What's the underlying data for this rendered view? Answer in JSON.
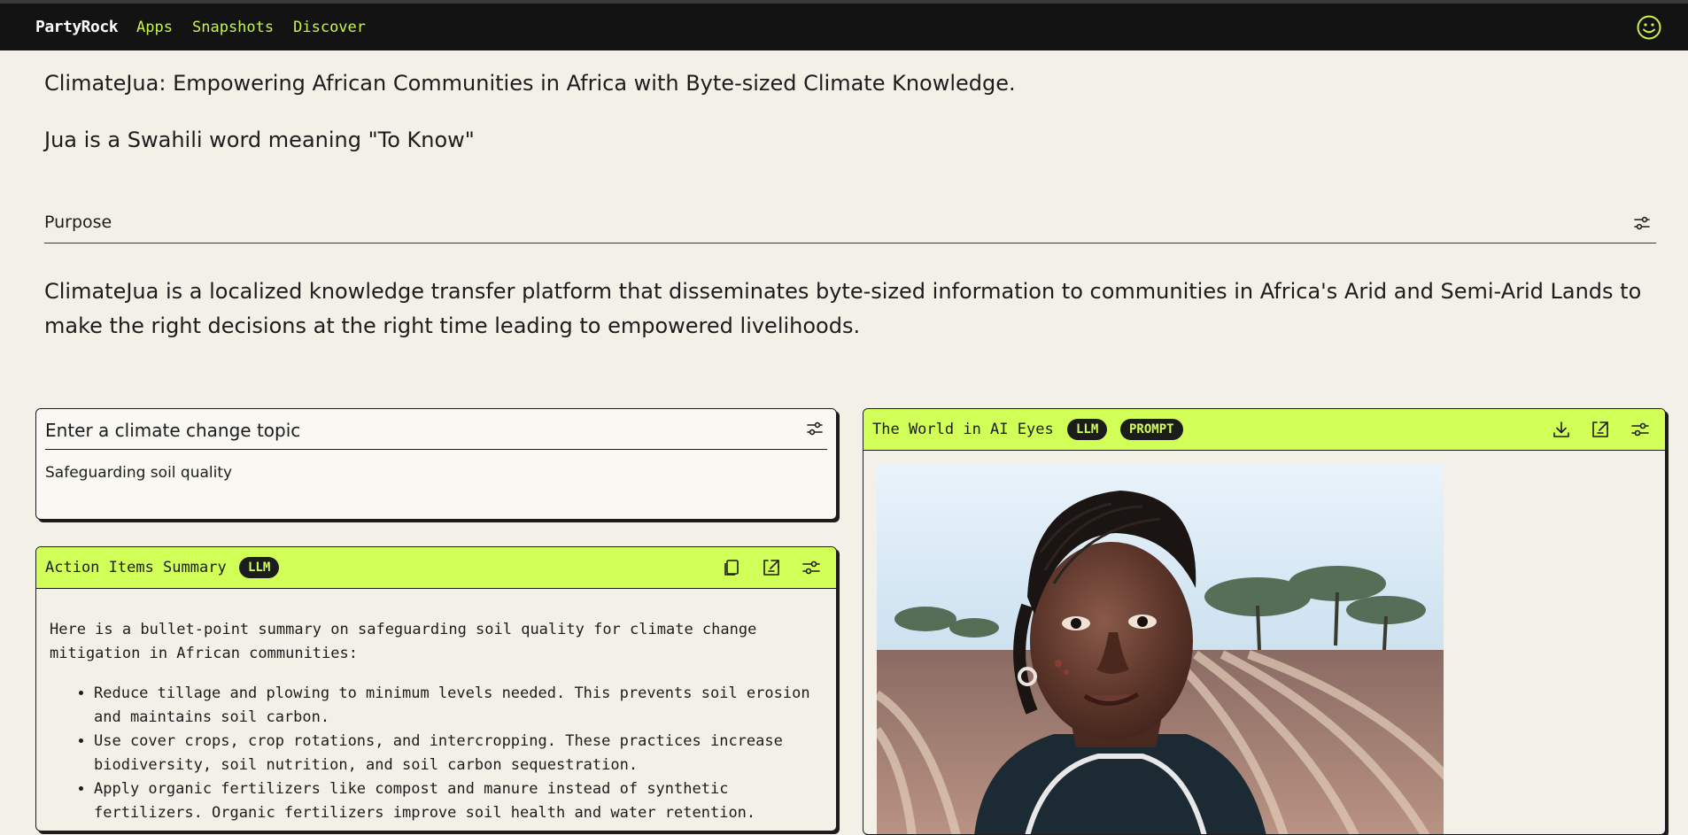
{
  "nav": {
    "brand": "PartyRock",
    "links": [
      "Apps",
      "Snapshots",
      "Discover"
    ]
  },
  "headline": "ClimateJua: Empowering African Communities in Africa with Byte-sized Climate Knowledge.",
  "subline": "Jua is a Swahili word meaning \"To Know\"",
  "purpose": {
    "label": "Purpose",
    "text": "ClimateJua is a localized knowledge transfer platform that disseminates byte-sized information to communities in Africa's Arid and Semi-Arid Lands to make the right decisions at the right time leading to empowered livelihoods."
  },
  "input_widget": {
    "title": "Enter a climate change topic",
    "value": "Safeguarding soil quality"
  },
  "summary_widget": {
    "title": "Action Items Summary",
    "badge": "LLM",
    "intro": "Here is a bullet-point summary on safeguarding soil quality for climate change mitigation in African communities:",
    "items": [
      "Reduce tillage and plowing to minimum levels needed. This prevents soil erosion and maintains soil carbon.",
      "Use cover crops, crop rotations, and intercropping. These practices increase biodiversity, soil nutrition, and soil carbon sequestration.",
      "Apply organic fertilizers like compost and manure instead of synthetic fertilizers. Organic fertilizers improve soil health and water retention."
    ]
  },
  "image_widget": {
    "title": "The World in AI Eyes",
    "badges": [
      "LLM",
      "PROMPT"
    ]
  },
  "colors": {
    "accent": "#d2ff57",
    "nav_link": "#c8f34a",
    "background": "#f3f1e7",
    "navbar": "#131313"
  },
  "icons": {
    "account": "smiley-face-icon",
    "settings": "sliders-icon",
    "copy": "copy-icon",
    "share": "share-icon",
    "download": "download-icon"
  }
}
